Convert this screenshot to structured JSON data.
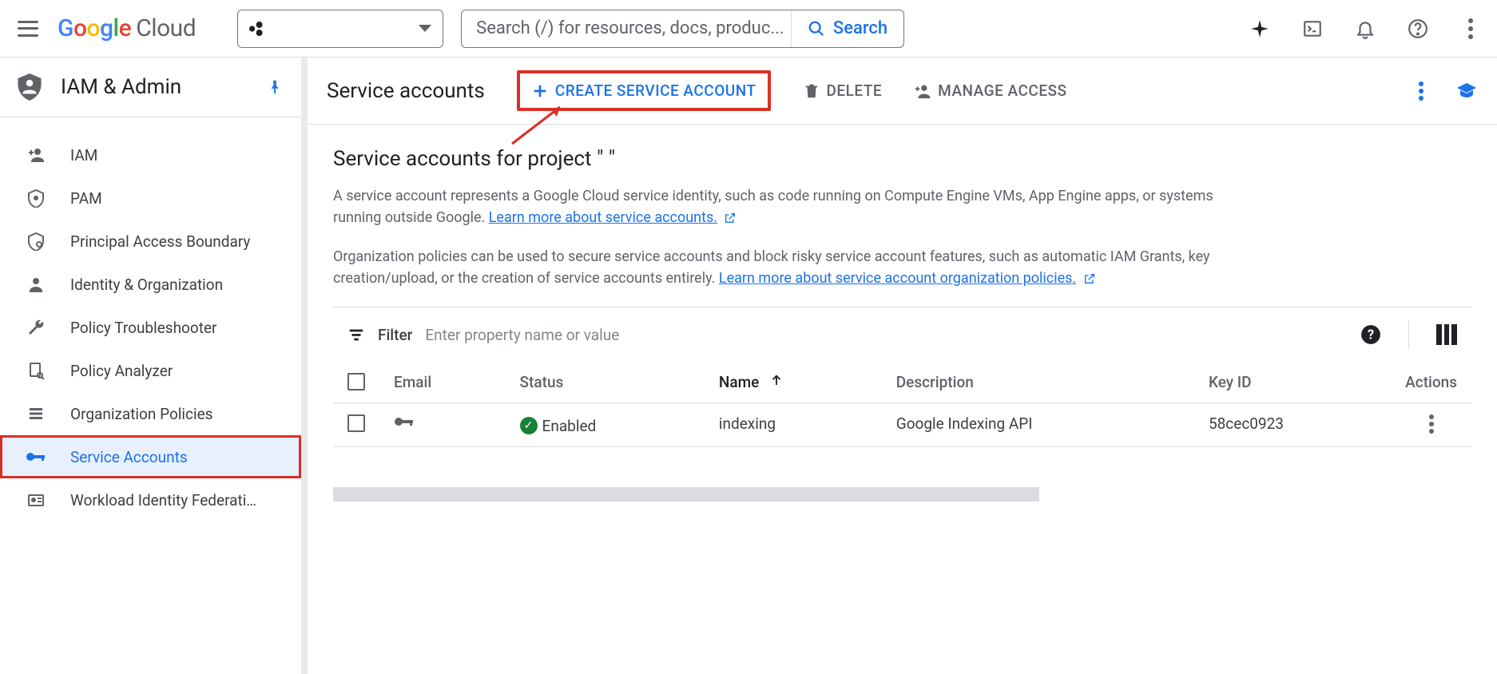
{
  "header": {
    "logo_word": "Google",
    "logo_sub": "Cloud",
    "search_placeholder": "Search (/) for resources, docs, produc...",
    "search_button": "Search"
  },
  "sidebar": {
    "section_title": "IAM & Admin",
    "items": [
      {
        "label": "IAM",
        "icon": "person-plus"
      },
      {
        "label": "PAM",
        "icon": "shield"
      },
      {
        "label": "Principal Access Boundary",
        "icon": "shield-outline"
      },
      {
        "label": "Identity & Organization",
        "icon": "account"
      },
      {
        "label": "Policy Troubleshooter",
        "icon": "wrench"
      },
      {
        "label": "Policy Analyzer",
        "icon": "doc-search"
      },
      {
        "label": "Organization Policies",
        "icon": "list"
      },
      {
        "label": "Service Accounts",
        "icon": "key"
      },
      {
        "label": "Workload Identity Federati…",
        "icon": "id-card"
      }
    ]
  },
  "page": {
    "title": "Service accounts",
    "actions": {
      "create": "CREATE SERVICE ACCOUNT",
      "delete": "DELETE",
      "manage": "MANAGE ACCESS"
    },
    "subtitle": "Service accounts for project \"                          \"",
    "desc1_a": "A service account represents a Google Cloud service identity, such as code running on Compute Engine VMs, App Engine apps, or systems running outside Google. ",
    "desc1_link": "Learn more about service accounts.",
    "desc2_a": "Organization policies can be used to secure service accounts and block risky service account features, such as automatic IAM Grants, key creation/upload, or the creation of service accounts entirely. ",
    "desc2_link": "Learn more about service account organization policies."
  },
  "table": {
    "filter_label": "Filter",
    "filter_placeholder": "Enter property name or value",
    "columns": {
      "email": "Email",
      "status": "Status",
      "name": "Name",
      "description": "Description",
      "keyid": "Key ID",
      "actions": "Actions"
    },
    "rows": [
      {
        "email": "",
        "status": "Enabled",
        "name": "indexing",
        "description": "Google Indexing API",
        "keyid": "58cec0923"
      }
    ]
  }
}
